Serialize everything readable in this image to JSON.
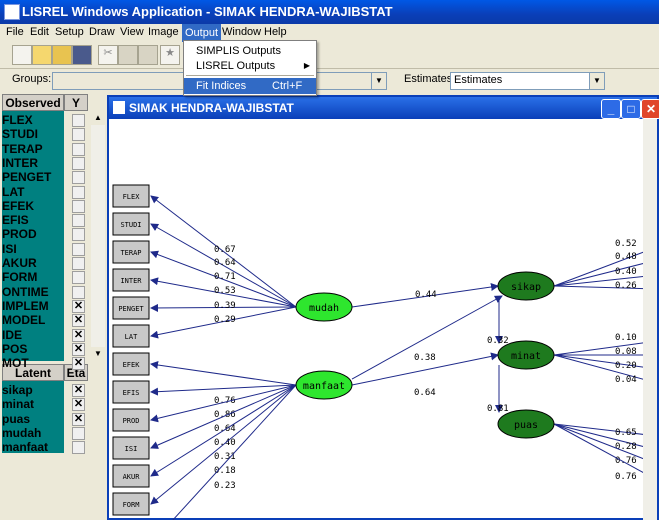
{
  "app": {
    "title": "LISREL Windows Application - SIMAK HENDRA-WAJIBSTAT"
  },
  "menu": [
    "File",
    "Edit",
    "Setup",
    "Draw",
    "View",
    "Image",
    "Output",
    "Window",
    "Help"
  ],
  "dropdown": {
    "items": [
      "SIMPLIS Outputs",
      "LISREL Outputs",
      "Fit Indices"
    ],
    "shortcut": "Ctrl+F"
  },
  "groupsbar": {
    "groups_label": "Groups:",
    "estimates_label": "Estimates:",
    "estimates_value": "Estimates"
  },
  "observed_header": "Observed",
  "y_header": "Y",
  "observed": [
    "FLEX",
    "STUDI",
    "TERAP",
    "INTER",
    "PENGET",
    "LAT",
    "EFEK",
    "EFIS",
    "PROD",
    "ISI",
    "AKUR",
    "FORM",
    "ONTIME",
    "IMPLEM",
    "MODEL",
    "IDE",
    "POS",
    "MOT"
  ],
  "observed_checked": [
    false,
    false,
    false,
    false,
    false,
    false,
    false,
    false,
    false,
    false,
    false,
    false,
    false,
    true,
    true,
    true,
    true,
    true
  ],
  "latent_header": "Latent",
  "eta_header": "Eta",
  "latent": [
    "sikap",
    "minat",
    "puas",
    "mudah",
    "manfaat"
  ],
  "latent_checked": [
    true,
    true,
    true,
    false,
    false
  ],
  "child": {
    "title": "SIMAK HENDRA-WAJIBSTAT"
  },
  "diagram": {
    "left_boxes": [
      "FLEX",
      "STUDI",
      "TERAP",
      "INTER",
      "PENGET",
      "LAT",
      "EFEK",
      "EFIS",
      "PROD",
      "ISI",
      "AKUR",
      "FORM"
    ],
    "mudah_loadings": [
      "0.67",
      "0.64",
      "0.71",
      "0.53",
      "0.39",
      "0.29"
    ],
    "manfaat_loadings": [
      "0.76",
      "0.86",
      "0.64",
      "0.40",
      "0.31",
      "0.18",
      "0.23"
    ],
    "latent_nodes": [
      "mudah",
      "manfaat",
      "sikap",
      "minat",
      "puas"
    ],
    "paths": [
      "0.44",
      "0.38",
      "0.64",
      "0.32",
      "0.81"
    ],
    "sikap_loadings": [
      "0.52",
      "0.48",
      "0.40",
      "0.26"
    ],
    "minat_loadings": [
      "0.10",
      "0.08",
      "0.20",
      "0.04"
    ],
    "puas_loadings": [
      "0.65",
      "0.28",
      "0.76",
      "0.76"
    ]
  }
}
